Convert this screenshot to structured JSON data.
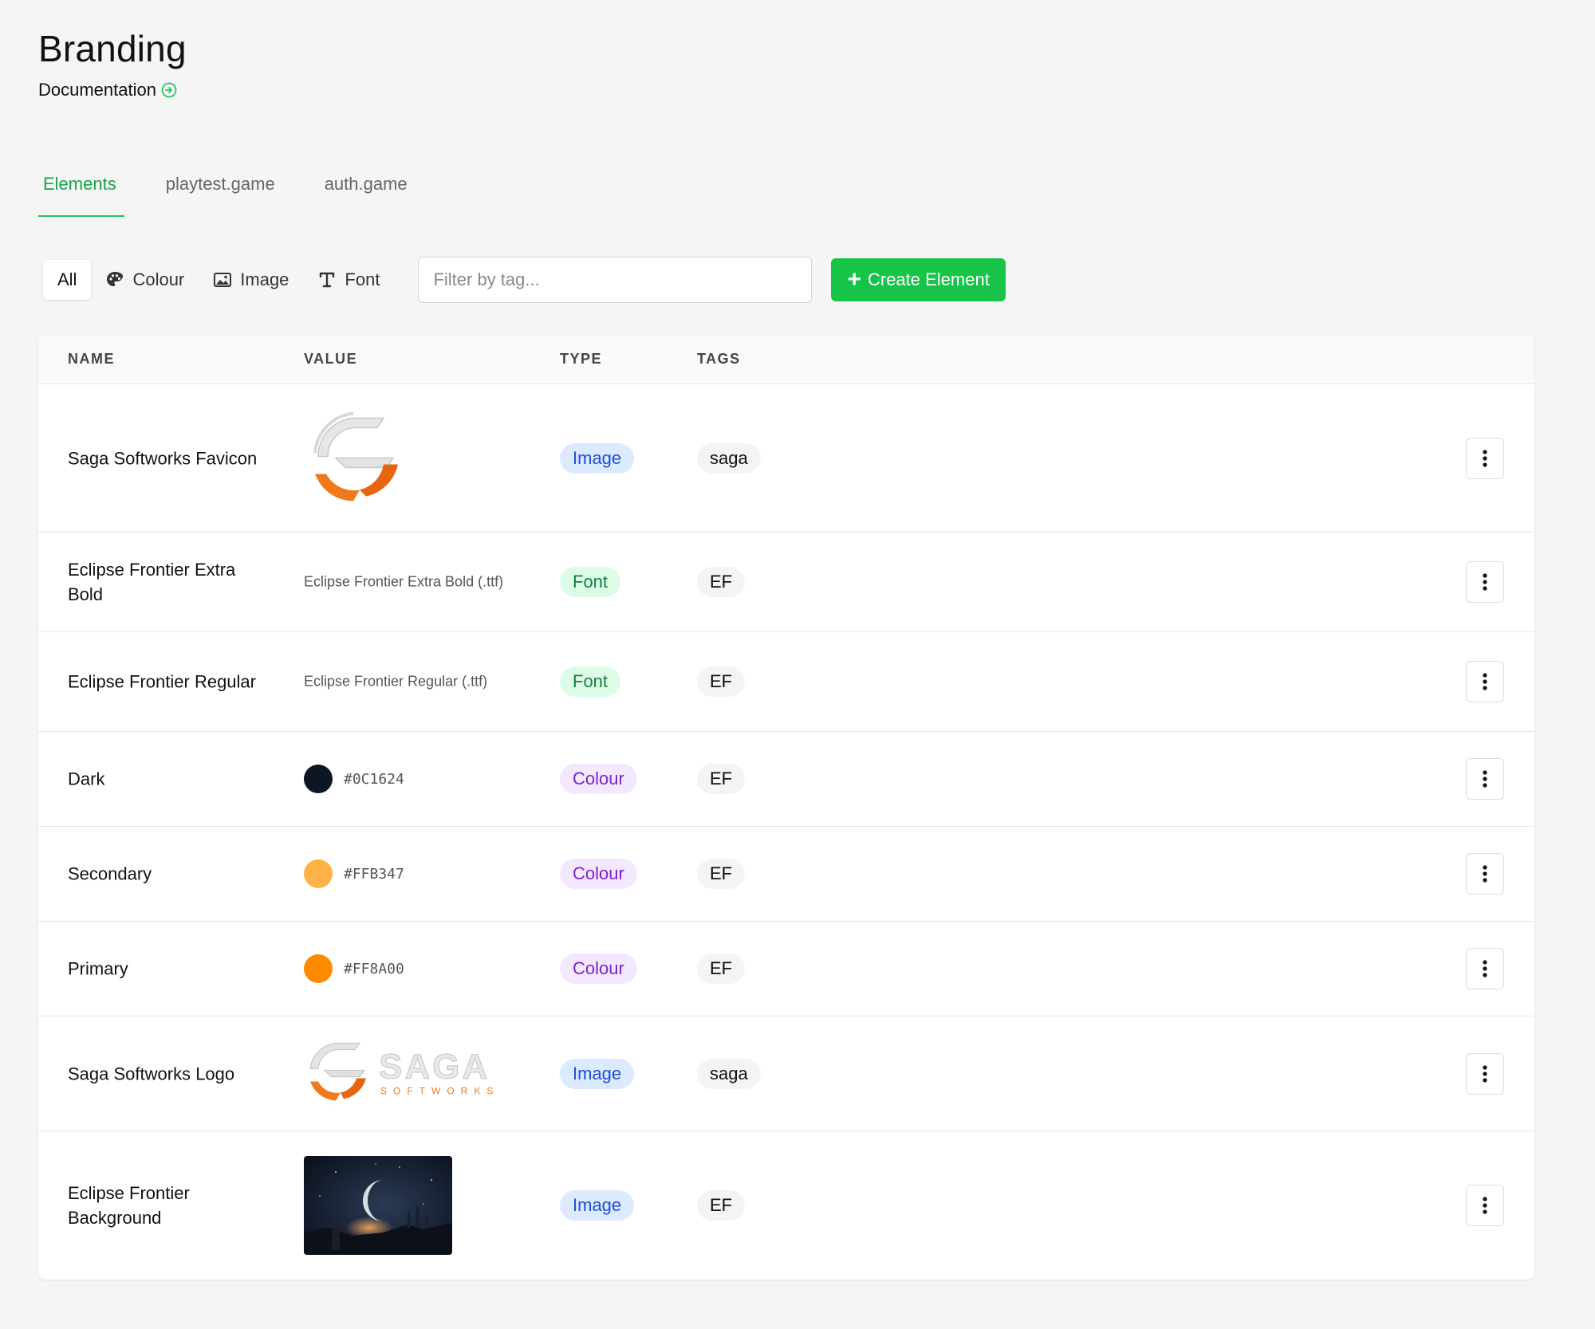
{
  "page": {
    "title": "Branding",
    "doc_link": "Documentation"
  },
  "tabs": [
    {
      "label": "Elements",
      "active": true
    },
    {
      "label": "playtest.game",
      "active": false
    },
    {
      "label": "auth.game",
      "active": false
    }
  ],
  "filters": {
    "all": "All",
    "colour": "Colour",
    "image": "Image",
    "font": "Font",
    "tag_placeholder": "Filter by tag...",
    "create_label": "Create Element"
  },
  "table": {
    "headers": {
      "name": "NAME",
      "value": "VALUE",
      "type": "TYPE",
      "tags": "TAGS"
    },
    "rows": [
      {
        "name": "Saga Softworks Favicon",
        "value_kind": "favicon",
        "type": "Image",
        "tag": "saga"
      },
      {
        "name": "Eclipse Frontier Extra Bold",
        "value_kind": "text",
        "value": "Eclipse Frontier Extra Bold (.ttf)",
        "type": "Font",
        "tag": "EF"
      },
      {
        "name": "Eclipse Frontier Regular",
        "value_kind": "text",
        "value": "Eclipse Frontier Regular (.ttf)",
        "type": "Font",
        "tag": "EF"
      },
      {
        "name": "Dark",
        "value_kind": "colour",
        "value": "#0C1624",
        "type": "Colour",
        "tag": "EF"
      },
      {
        "name": "Secondary",
        "value_kind": "colour",
        "value": "#FFB347",
        "type": "Colour",
        "tag": "EF"
      },
      {
        "name": "Primary",
        "value_kind": "colour",
        "value": "#FF8A00",
        "type": "Colour",
        "tag": "EF"
      },
      {
        "name": "Saga Softworks Logo",
        "value_kind": "logo",
        "logo_word": "SAGA",
        "logo_sub": "SOFTWORKS",
        "type": "Image",
        "tag": "saga"
      },
      {
        "name": "Eclipse Frontier Background",
        "value_kind": "background",
        "type": "Image",
        "tag": "EF"
      }
    ]
  },
  "colors": {
    "accent_green": "#16c447",
    "tab_active": "#16a34a",
    "brand_orange": "#f07a1a"
  },
  "icons": [
    "arrow-right-circle-icon",
    "palette-icon",
    "image-icon",
    "font-icon",
    "plus-icon",
    "kebab-menu-icon"
  ]
}
